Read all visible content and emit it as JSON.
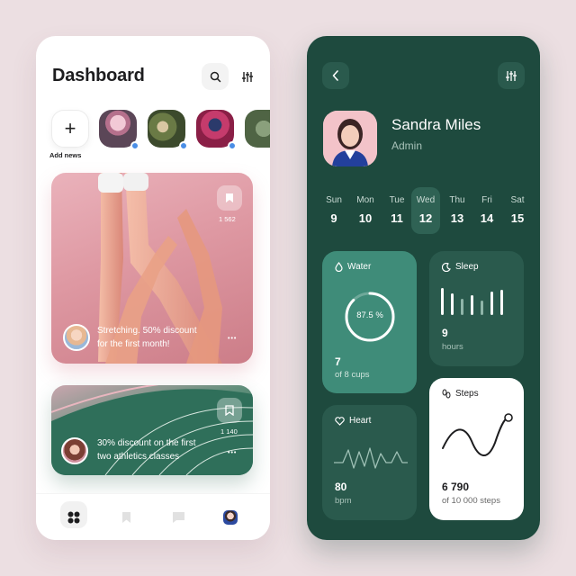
{
  "dashboard": {
    "title": "Dashboard",
    "stories": {
      "add_label": "Add news"
    },
    "posts": [
      {
        "text_line1": "Stretching. 50% discount",
        "text_line2": "for the first month!",
        "count": "1 562",
        "more": "•••"
      },
      {
        "text_line1": "30% discount on the first",
        "text_line2": "two athletics classes",
        "count": "1 140",
        "more": "•••"
      }
    ],
    "nav": [
      "grid-icon",
      "bookmark-icon",
      "chat-icon",
      "profile-avatar"
    ]
  },
  "profile": {
    "name": "Sandra Miles",
    "role": "Admin",
    "week": [
      {
        "name": "Sun",
        "date": "9"
      },
      {
        "name": "Mon",
        "date": "10"
      },
      {
        "name": "Tue",
        "date": "11"
      },
      {
        "name": "Wed",
        "date": "12"
      },
      {
        "name": "Thu",
        "date": "13"
      },
      {
        "name": "Fri",
        "date": "14"
      },
      {
        "name": "Sat",
        "date": "15"
      }
    ],
    "active_day": "Wed",
    "water": {
      "label": "Water",
      "percent": "87.5 %",
      "value": "7",
      "sub": "of 8 cups",
      "progress": 0.875
    },
    "sleep": {
      "label": "Sleep",
      "value": "9",
      "sub": "hours"
    },
    "heart": {
      "label": "Heart",
      "value": "80",
      "sub": "bpm"
    },
    "steps": {
      "label": "Steps",
      "value": "6 790",
      "sub": "of 10 000 steps"
    }
  },
  "colors": {
    "background": "#ecdfe2",
    "dark_green": "#1e4a3e",
    "tile_green": "#2f6254",
    "water_tile": "#3f8c79",
    "white": "#ffffff"
  }
}
